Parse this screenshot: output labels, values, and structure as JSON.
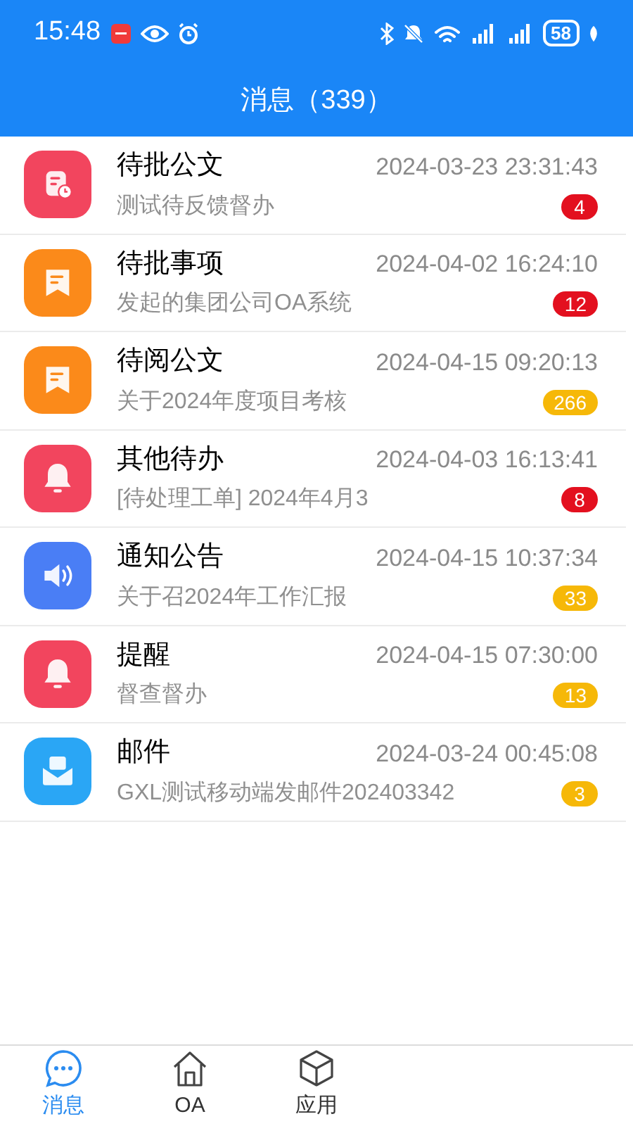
{
  "status_bar": {
    "time": "15:48",
    "battery": "58"
  },
  "header": {
    "title": "消息（339）"
  },
  "messages": [
    {
      "kind": "document",
      "title": "待批公文",
      "time": "2024-03-23 23:31:43",
      "preview": "测试待反馈督办",
      "badge": {
        "count": "4",
        "color": "#e3101f"
      }
    },
    {
      "kind": "flag",
      "title": "待批事项",
      "time": "2024-04-02 16:24:10",
      "preview": "发起的集团公司OA系统",
      "badge": {
        "count": "12",
        "color": "#e3101f"
      }
    },
    {
      "kind": "flag",
      "title": "待阅公文",
      "time": "2024-04-15 09:20:13",
      "preview": "关于2024年度项目考核",
      "badge": {
        "count": "266",
        "color": "#f6b808"
      }
    },
    {
      "kind": "bell",
      "title": "其他待办",
      "time": "2024-04-03 16:13:41",
      "preview": "[待处理工单] 2024年4月3",
      "badge": {
        "count": "8",
        "color": "#e3101f"
      }
    },
    {
      "kind": "speaker",
      "title": "通知公告",
      "time": "2024-04-15 10:37:34",
      "preview": "关于召2024年工作汇报",
      "badge": {
        "count": "33",
        "color": "#f6b808"
      }
    },
    {
      "kind": "bell",
      "title": "提醒",
      "time": "2024-04-15 07:30:00",
      "preview": "督查督办",
      "badge": {
        "count": "13",
        "color": "#f6b808"
      }
    },
    {
      "kind": "mail",
      "title": "邮件",
      "time": "2024-03-24 00:45:08",
      "preview": "GXL测试移动端发邮件202403342",
      "badge": {
        "count": "3",
        "color": "#f6b808"
      }
    }
  ],
  "tabs": [
    {
      "kind": "chat",
      "label": "消息",
      "selected": true
    },
    {
      "kind": "home",
      "label": "OA",
      "selected": false
    },
    {
      "kind": "cube",
      "label": "应用",
      "selected": false
    }
  ]
}
